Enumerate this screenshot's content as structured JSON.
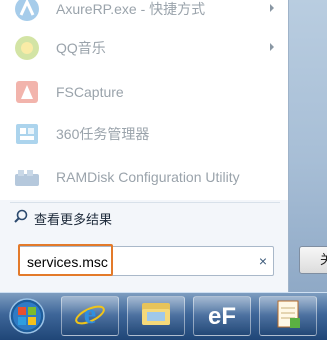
{
  "programs": [
    {
      "label": "AxureRP.exe - 快捷方式",
      "icon": "axure-icon",
      "has_submenu": true
    },
    {
      "label": "QQ音乐",
      "icon": "qq-music-icon",
      "has_submenu": true
    },
    {
      "label": "FSCapture",
      "icon": "fscapture-icon",
      "has_submenu": false
    },
    {
      "label": "360任务管理器",
      "icon": "360-task-manager-icon",
      "has_submenu": false
    },
    {
      "label": "RAMDisk Configuration Utility",
      "icon": "ramdisk-icon",
      "has_submenu": false
    }
  ],
  "see_more": {
    "label": "查看更多结果"
  },
  "search": {
    "value": "services.msc"
  },
  "shutdown": {
    "label": "关"
  },
  "taskbar": {
    "items": [
      {
        "name": "start-orb"
      },
      {
        "name": "internet-explorer-icon"
      },
      {
        "name": "file-explorer-icon"
      },
      {
        "name": "ef-app-icon"
      },
      {
        "name": "notepad-app-icon"
      }
    ]
  },
  "colors": {
    "highlight": "#e37a2a",
    "taskbar": "#2f5a8b"
  }
}
